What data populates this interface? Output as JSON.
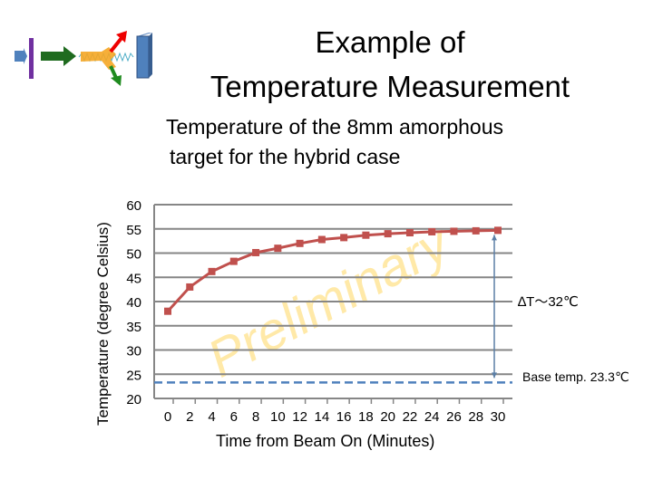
{
  "title_line1": "Example of",
  "title_line2": "Temperature Measurement",
  "chart_data": {
    "type": "line",
    "title_line1": "Temperature of the 8mm amorphous",
    "title_line2": "target for the hybrid case",
    "xlabel": "Time from Beam On (Minutes)",
    "ylabel": "Temperature (degree Celsius)",
    "x": [
      0,
      2,
      4,
      6,
      8,
      10,
      12,
      14,
      16,
      18,
      20,
      22,
      24,
      26,
      28,
      30
    ],
    "values": [
      38,
      43,
      46.2,
      48.3,
      50.1,
      51,
      52,
      52.8,
      53.2,
      53.7,
      54,
      54.2,
      54.4,
      54.5,
      54.6,
      54.7
    ],
    "xlim": [
      0,
      30
    ],
    "ylim": [
      20,
      60
    ],
    "yticks": [
      20,
      25,
      30,
      35,
      40,
      45,
      50,
      55,
      60
    ],
    "grid": true,
    "series_color": "#C0504D",
    "baseline": 23.3,
    "baseline_color": "#4F81BD",
    "annotation_delta": "∆T～32℃",
    "annotation_base": "Base temp. 23.3℃",
    "watermark": "Preliminary"
  }
}
